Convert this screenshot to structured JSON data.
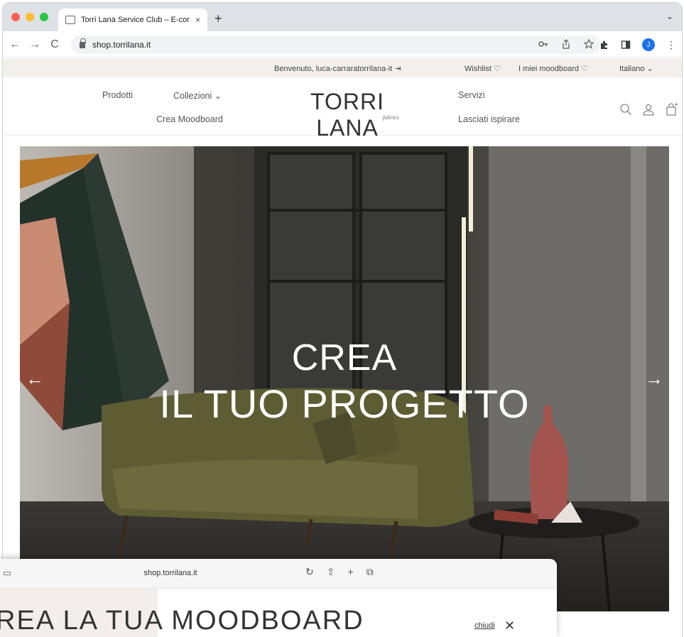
{
  "browser": {
    "tab_title": "Torri Lana Service Club – E-cor",
    "tab_close": "×",
    "new_tab": "+",
    "tab_menu": "⌄",
    "back": "←",
    "forward": "→",
    "reload": "C",
    "url": "shop.torrilana.it",
    "profile_initial": "J"
  },
  "utility_bar": {
    "welcome": "Benvenuto, luca-carraratorrilana-it",
    "wishlist": "Wishlist",
    "moodboard": "I miei moodboard",
    "language": "Italiano"
  },
  "header": {
    "nav_prodotti": "Prodotti",
    "nav_collezioni": "Collezioni",
    "nav_crea_moodboard": "Crea Moodboard",
    "logo": "TORRI LANA",
    "logo_sub": "fabrics",
    "nav_servizi": "Servizi",
    "nav_lasciati": "Lasciati ispirare"
  },
  "hero": {
    "line1": "CREA",
    "line2": "IL TUO PROGETTO",
    "prev": "←",
    "next": "→"
  },
  "popup": {
    "url": "shop.torrilana.it",
    "title": "REA LA TUA MOODBOARD",
    "close_label": "chiudi",
    "close_x": "✕"
  }
}
